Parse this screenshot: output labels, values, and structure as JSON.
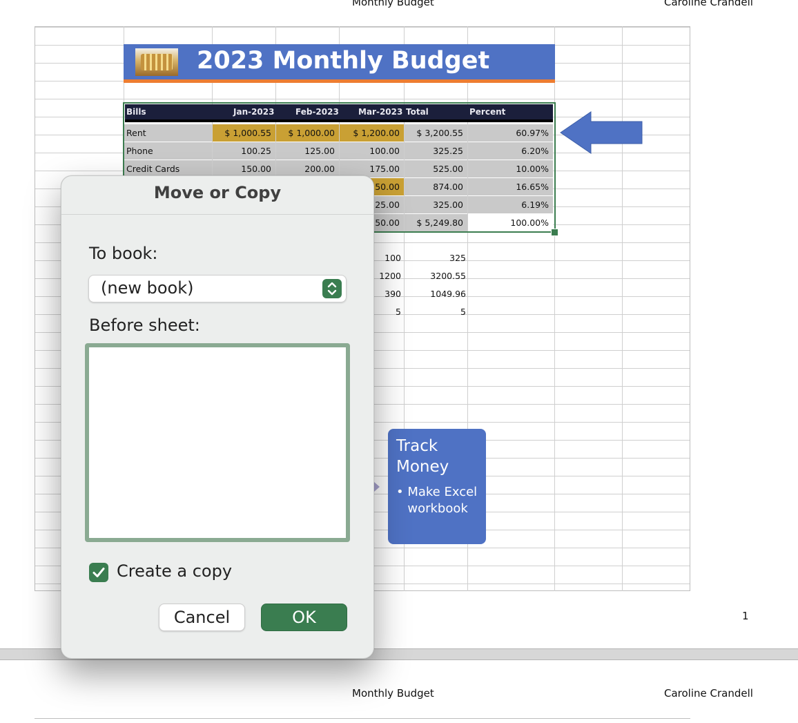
{
  "page_header": {
    "center": "Monthly Budget",
    "right": "Caroline Crandell"
  },
  "page_number": "1",
  "title": "2023 Monthly Budget",
  "table": {
    "headers": [
      "Bills",
      "Jan-2023",
      "Feb-2023",
      "Mar-2023",
      "Total",
      "Percent"
    ],
    "rows": [
      [
        "Rent",
        "$   1,000.55",
        "$   1,000.00",
        "$   1,200.00",
        "$   3,200.55",
        "60.97%"
      ],
      [
        "Phone",
        "100.25",
        "125.00",
        "100.00",
        "325.25",
        "6.20%"
      ],
      [
        "Credit Cards",
        "150.00",
        "200.00",
        "175.00",
        "525.00",
        "10.00%"
      ]
    ],
    "partial_rows": [
      [
        "50.00",
        "874.00",
        "16.65%"
      ],
      [
        "25.00",
        "325.00",
        "6.19%"
      ],
      [
        "50.00",
        "$   5,249.80",
        "100.00%"
      ]
    ]
  },
  "extra_rows": [
    [
      "100",
      "325"
    ],
    [
      "1200",
      "3200.55"
    ],
    [
      "390",
      "1049.96"
    ],
    [
      "5",
      "5"
    ]
  ],
  "callout": {
    "title": "Track Money",
    "bullet": "Make Excel workbook"
  },
  "colors": {
    "accent_blue": "#4f72c4",
    "accent_orange": "#ed7d31",
    "gold": "#c9a034",
    "excel_green": "#3a7d50"
  },
  "dialog": {
    "title": "Move or Copy",
    "to_book_label": "To book:",
    "to_book_value": "(new book)",
    "before_sheet_label": "Before sheet:",
    "before_sheet_items": [],
    "create_copy_label": "Create a copy",
    "create_copy_checked": true,
    "cancel_label": "Cancel",
    "ok_label": "OK"
  },
  "next_page_header": {
    "center": "Monthly Budget",
    "right": "Caroline Crandell"
  }
}
